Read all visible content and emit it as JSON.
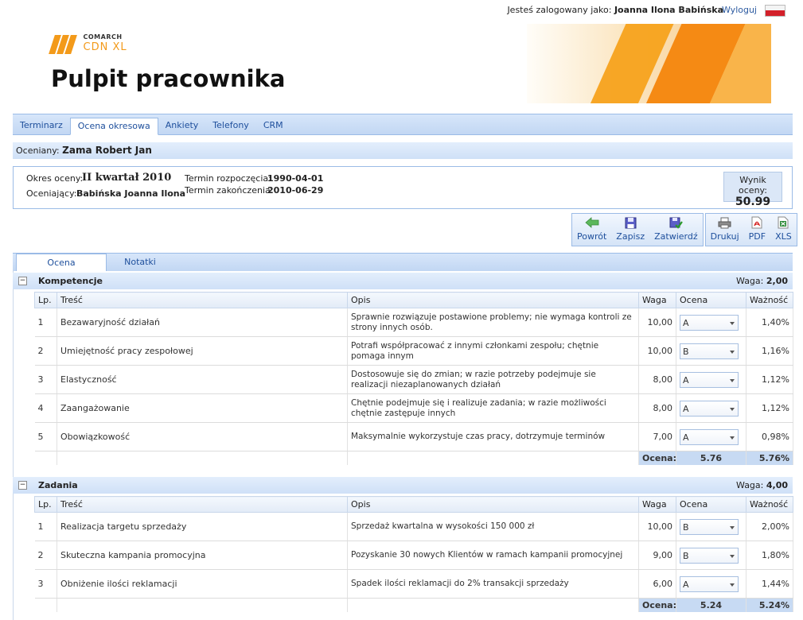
{
  "top": {
    "logged_prefix": "Jesteś zalogowany jako:",
    "user": "Joanna Ilona Babińska",
    "logout": "Wyloguj"
  },
  "logo": {
    "company": "COMARCH",
    "product": "CDN XL"
  },
  "page_title": "Pulpit pracownika",
  "tabs": [
    "Terminarz",
    "Ocena okresowa",
    "Ankiety",
    "Telefony",
    "CRM"
  ],
  "active_tab": "Ocena okresowa",
  "evaluated": {
    "label": "Oceniany:",
    "name": "Zama Robert Jan"
  },
  "info": {
    "period_label": "Okres oceny:",
    "period": "II kwartał 2010",
    "evaluator_label": "Oceniający:",
    "evaluator": "Babińska Joanna Ilona",
    "start_label": "Termin rozpoczęcia:",
    "start": "1990-04-01",
    "end_label": "Termin zakończenia:",
    "end": "2010-06-29",
    "result_label": "Wynik oceny:",
    "result": "50.99"
  },
  "toolbar": {
    "back": "Powrót",
    "save": "Zapisz",
    "approve": "Zatwierdź",
    "print": "Drukuj",
    "pdf": "PDF",
    "xls": "XLS"
  },
  "subtabs": [
    "Ocena",
    "Notatki"
  ],
  "columns": {
    "lp": "Lp.",
    "tresc": "Treść",
    "opis": "Opis",
    "waga": "Waga",
    "ocena": "Ocena",
    "waznosc": "Ważność"
  },
  "sections": [
    {
      "name": "Kompetencje",
      "weight_label": "Waga:",
      "weight": "2,00",
      "rows": [
        {
          "lp": "1",
          "tresc": "Bezawaryjność działań",
          "opis": "Sprawnie rozwiązuje postawione problemy; nie wymaga kontroli ze strony innych osób.",
          "waga": "10,00",
          "ocena": "A",
          "waznosc": "1,40%"
        },
        {
          "lp": "2",
          "tresc": "Umiejętność pracy zespołowej",
          "opis": "Potrafi współpracować z innymi członkami zespołu; chętnie pomaga innym",
          "waga": "10,00",
          "ocena": "B",
          "waznosc": "1,16%"
        },
        {
          "lp": "3",
          "tresc": "Elastyczność",
          "opis": "Dostosowuje się do zmian; w razie potrzeby podejmuje sie realizacji niezaplanowanych działań",
          "waga": "8,00",
          "ocena": "A",
          "waznosc": "1,12%"
        },
        {
          "lp": "4",
          "tresc": "Zaangażowanie",
          "opis": "Chętnie podejmuje się i realizuje zadania; w razie możliwości chętnie zastępuje innych",
          "waga": "8,00",
          "ocena": "A",
          "waznosc": "1,12%"
        },
        {
          "lp": "5",
          "tresc": "Obowiązkowość",
          "opis": "Maksymalnie wykorzystuje czas pracy, dotrzymuje terminów",
          "waga": "7,00",
          "ocena": "A",
          "waznosc": "0,98%"
        }
      ],
      "sum_label": "Ocena:",
      "sum_value": "5.76",
      "sum_pct": "5.76%"
    },
    {
      "name": "Zadania",
      "weight_label": "Waga:",
      "weight": "4,00",
      "rows": [
        {
          "lp": "1",
          "tresc": "Realizacja targetu sprzedaży",
          "opis": "Sprzedaż kwartalna w wysokości 150 000 zł",
          "waga": "10,00",
          "ocena": "B",
          "waznosc": "2,00%"
        },
        {
          "lp": "2",
          "tresc": "Skuteczna kampania promocyjna",
          "opis": "Pozyskanie 30 nowych Klientów w ramach kampanii promocyjnej",
          "waga": "9,00",
          "ocena": "B",
          "waznosc": "1,80%"
        },
        {
          "lp": "3",
          "tresc": "Obniżenie ilości reklamacji",
          "opis": "Spadek ilości reklamacji do 2% transakcji sprzedaży",
          "waga": "6,00",
          "ocena": "A",
          "waznosc": "1,44%"
        }
      ],
      "sum_label": "Ocena:",
      "sum_value": "5.24",
      "sum_pct": "5.24%"
    }
  ]
}
